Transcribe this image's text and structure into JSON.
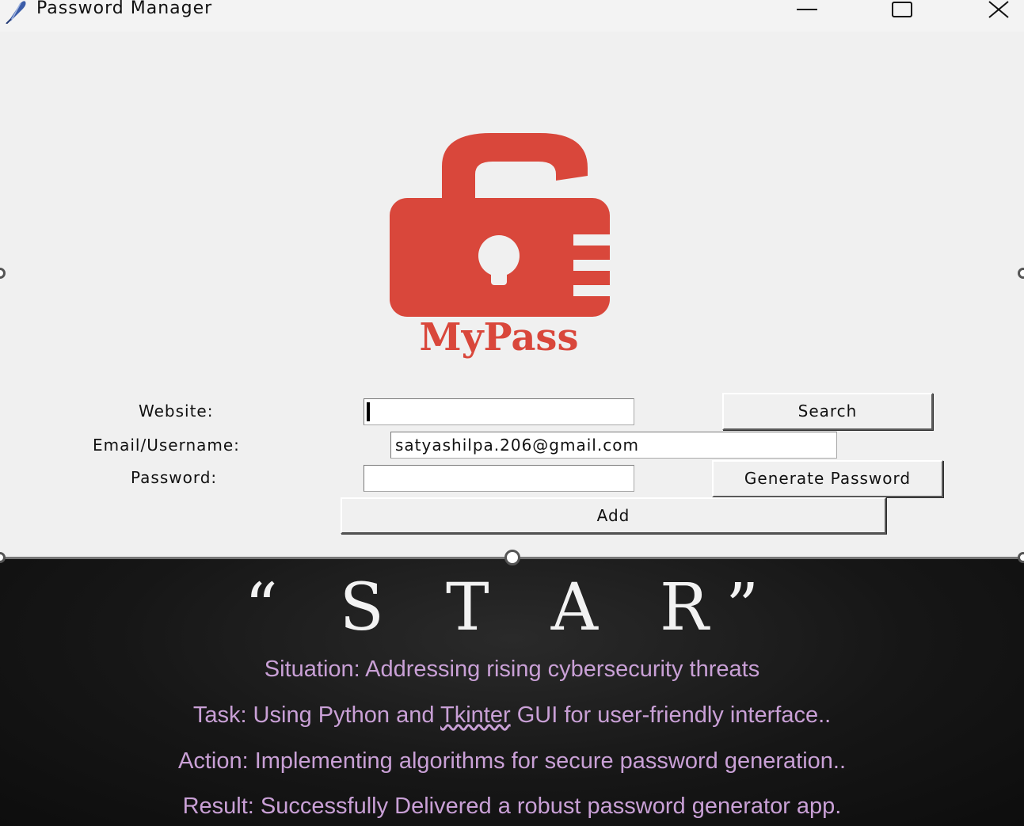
{
  "window": {
    "title": "Password Manager",
    "icon": "feather-icon"
  },
  "logo": {
    "text": "MyPass",
    "icon": "padlock-icon",
    "color": "#d9473b"
  },
  "form": {
    "website_label": "Website:",
    "website_value": "",
    "email_label": "Email/Username:",
    "email_value": "satyashilpa.206@gmail.com",
    "password_label": "Password:",
    "password_value": ""
  },
  "buttons": {
    "search": "Search",
    "generate": "Generate Password",
    "add": "Add"
  },
  "slide": {
    "title": "“ S T A R”",
    "situation": "Situation: Addressing rising cybersecurity threats",
    "task_prefix": "Task: Using Python and ",
    "task_underlined": "Tkinter",
    "task_suffix": " GUI for user-friendly interface..",
    "action": "Action: Implementing algorithms for secure password generation..",
    "result": "Result: Successfully Delivered a robust password generator app.",
    "text_color": "#c9a0d6"
  }
}
